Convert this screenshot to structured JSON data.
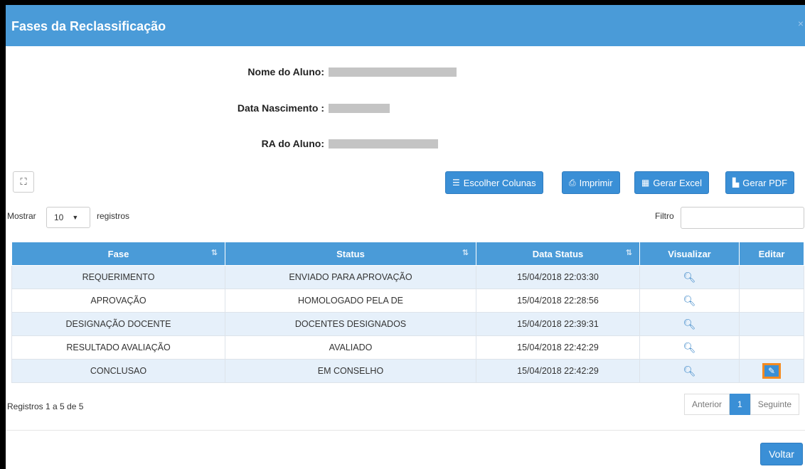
{
  "modal": {
    "title": "Fases da Reclassificação",
    "close_glyph": "×"
  },
  "student": {
    "name_label": "Nome do Aluno:",
    "birth_label": "Data Nascimento :",
    "ra_label": "RA do Aluno:"
  },
  "toolbar": {
    "expand_glyph": "⛶",
    "columns_label": "Escolher Colunas",
    "print_label": "Imprimir",
    "excel_label": "Gerar Excel",
    "pdf_label": "Gerar PDF"
  },
  "length_menu": {
    "prefix": "Mostrar",
    "value": "10",
    "suffix": "registros"
  },
  "filter": {
    "label": "Filtro",
    "value": ""
  },
  "table": {
    "headers": [
      "Fase",
      "Status",
      "Data Status",
      "Visualizar",
      "Editar"
    ],
    "rows": [
      {
        "fase": "REQUERIMENTO",
        "status": "ENVIADO PARA APROVAÇÃO",
        "data": "15/04/2018 22:03:30",
        "editable": false
      },
      {
        "fase": "APROVAÇÃO",
        "status": "HOMOLOGADO PELA DE",
        "data": "15/04/2018 22:28:56",
        "editable": false
      },
      {
        "fase": "DESIGNAÇÃO DOCENTE",
        "status": "DOCENTES DESIGNADOS",
        "data": "15/04/2018 22:39:31",
        "editable": false
      },
      {
        "fase": "RESULTADO AVALIAÇÃO",
        "status": "AVALIADO",
        "data": "15/04/2018 22:42:29",
        "editable": false
      },
      {
        "fase": "CONCLUSAO",
        "status": "EM CONSELHO",
        "data": "15/04/2018 22:42:29",
        "editable": true
      }
    ]
  },
  "footer": {
    "info": "Registros 1 a 5 de 5",
    "prev_label": "Anterior",
    "page": "1",
    "next_label": "Seguinte",
    "back_label": "Voltar"
  },
  "colors": {
    "header": "#4a9bd8",
    "button": "#3a8fd6",
    "highlight": "#f58a1f",
    "row_alt": "#e6f0fa"
  }
}
